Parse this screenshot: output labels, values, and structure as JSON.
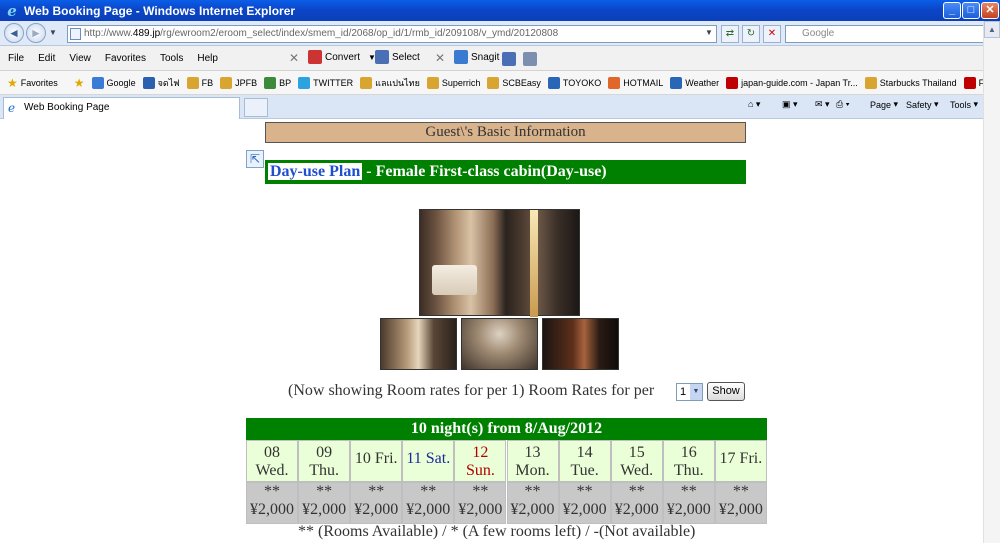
{
  "window": {
    "title": "Web Booking Page - Windows Internet Explorer"
  },
  "address": {
    "prefix": "http://www.",
    "domain": "489.jp",
    "path": "/rg/ewroom2/eroom_select/index/smem_id/2068/op_id/1/rmb_id/209108/v_ymd/20120808",
    "search_placeholder": "Google"
  },
  "menu": {
    "items": [
      "File",
      "Edit",
      "View",
      "Favorites",
      "Tools",
      "Help"
    ],
    "convert": "Convert",
    "select": "Select",
    "snagit": "Snagit"
  },
  "favorites": {
    "label": "Favorites",
    "items": [
      {
        "label": "Google",
        "color": "#3b7bd8"
      },
      {
        "label": "จดไฟ",
        "color": "#2b5fb0"
      },
      {
        "label": "FB",
        "color": "#d9a531"
      },
      {
        "label": "JPFB",
        "color": "#d9a531"
      },
      {
        "label": "BP",
        "color": "#3c8a3c"
      },
      {
        "label": "TWITTER",
        "color": "#2aa3e0"
      },
      {
        "label": "แลแปนไทย",
        "color": "#d9a531"
      },
      {
        "label": "Superrich",
        "color": "#d9a531"
      },
      {
        "label": "SCBEasy",
        "color": "#d9a531"
      },
      {
        "label": "TOYOKO",
        "color": "#2a66b8"
      },
      {
        "label": "HOTMAIL",
        "color": "#e0662a"
      },
      {
        "label": "Weather",
        "color": "#2a66b8"
      },
      {
        "label": "japan-guide.com - Japan Tr...",
        "color": "#c00000"
      },
      {
        "label": "Starbucks Thailand",
        "color": "#d9a531"
      },
      {
        "label": "FUJI",
        "color": "#c00000"
      }
    ]
  },
  "tab": {
    "title": "Web Booking Page"
  },
  "commands": {
    "page": "Page",
    "safety": "Safety",
    "tools": "Tools"
  },
  "page": {
    "guest_header": "Guest\\'s Basic Information",
    "plan_link": "Day-use Plan",
    "plan_rest": " - Female First-class cabin(Day-use)",
    "rates_text": "(Now showing Room rates for per 1) Room Rates for per",
    "rates_select": "1",
    "show_button": "Show",
    "calendar_title": "10 night(s) from 8/Aug/2012",
    "days": [
      {
        "num": "08",
        "dow": "Wed.",
        "color": "#333333"
      },
      {
        "num": "09",
        "dow": "Thu.",
        "color": "#333333"
      },
      {
        "num": "10",
        "dow": "Fri.",
        "color": "#333333"
      },
      {
        "num": "11",
        "dow": "Sat.",
        "color": "#1a2a9a"
      },
      {
        "num": "12",
        "dow": "Sun.",
        "color": "#b00000"
      },
      {
        "num": "13",
        "dow": "Mon.",
        "color": "#333333"
      },
      {
        "num": "14",
        "dow": "Tue.",
        "color": "#333333"
      },
      {
        "num": "15",
        "dow": "Wed.",
        "color": "#333333"
      },
      {
        "num": "16",
        "dow": "Thu.",
        "color": "#333333"
      },
      {
        "num": "17",
        "dow": "Fri.",
        "color": "#333333"
      }
    ],
    "availability": [
      "**",
      "**",
      "**",
      "**",
      "**",
      "**",
      "**",
      "**",
      "**",
      "**"
    ],
    "prices": [
      "¥2,000",
      "¥2,000",
      "¥2,000",
      "¥2,000",
      "¥2,000",
      "¥2,000",
      "¥2,000",
      "¥2,000",
      "¥2,000",
      "¥2,000"
    ],
    "legend": "** (Rooms Available) / * (A few rooms left) / -(Not available)"
  }
}
